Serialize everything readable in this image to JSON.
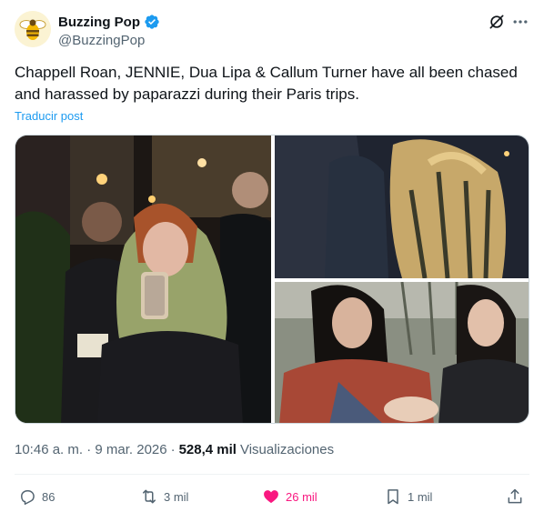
{
  "author": {
    "display_name": "Buzzing Pop",
    "handle": "@BuzzingPop",
    "verified": true,
    "avatar_icon": "bee-logo"
  },
  "tweet": {
    "text": "Chappell Roan, JENNIE, Dua Lipa & Callum Turner have all been chased and harassed by paparazzi during their Paris trips.",
    "translate_label": "Traducir post"
  },
  "media": {
    "count": 3
  },
  "meta": {
    "timestamp": "10:46 a. m. · 9 mar. 2026",
    "separator": "·",
    "views_count": "528,4 mil",
    "views_label": "Visualizaciones"
  },
  "actions": {
    "replies": "86",
    "reposts": "3 mil",
    "likes": "26 mil",
    "bookmarks": "1 mil"
  },
  "colors": {
    "accent": "#1d9bf0",
    "like_active": "#f91880",
    "secondary_text": "#536471",
    "primary_text": "#0f1419"
  }
}
